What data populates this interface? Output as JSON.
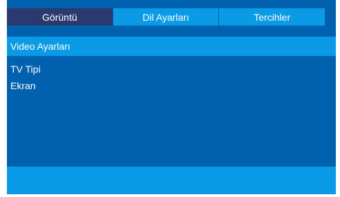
{
  "tabs": [
    {
      "label": "Görüntü",
      "active": true
    },
    {
      "label": "Dil Ayarları",
      "active": false
    },
    {
      "label": "Tercihler",
      "active": false
    }
  ],
  "section": {
    "title": "Video Ayarları"
  },
  "menu": {
    "items": [
      {
        "label": "TV Tipi"
      },
      {
        "label": "Ekran"
      }
    ]
  },
  "colors": {
    "panel": "#0062ae",
    "accent": "#0a9ae6",
    "active_tab": "#2b3a6e",
    "text": "#ffffff"
  }
}
